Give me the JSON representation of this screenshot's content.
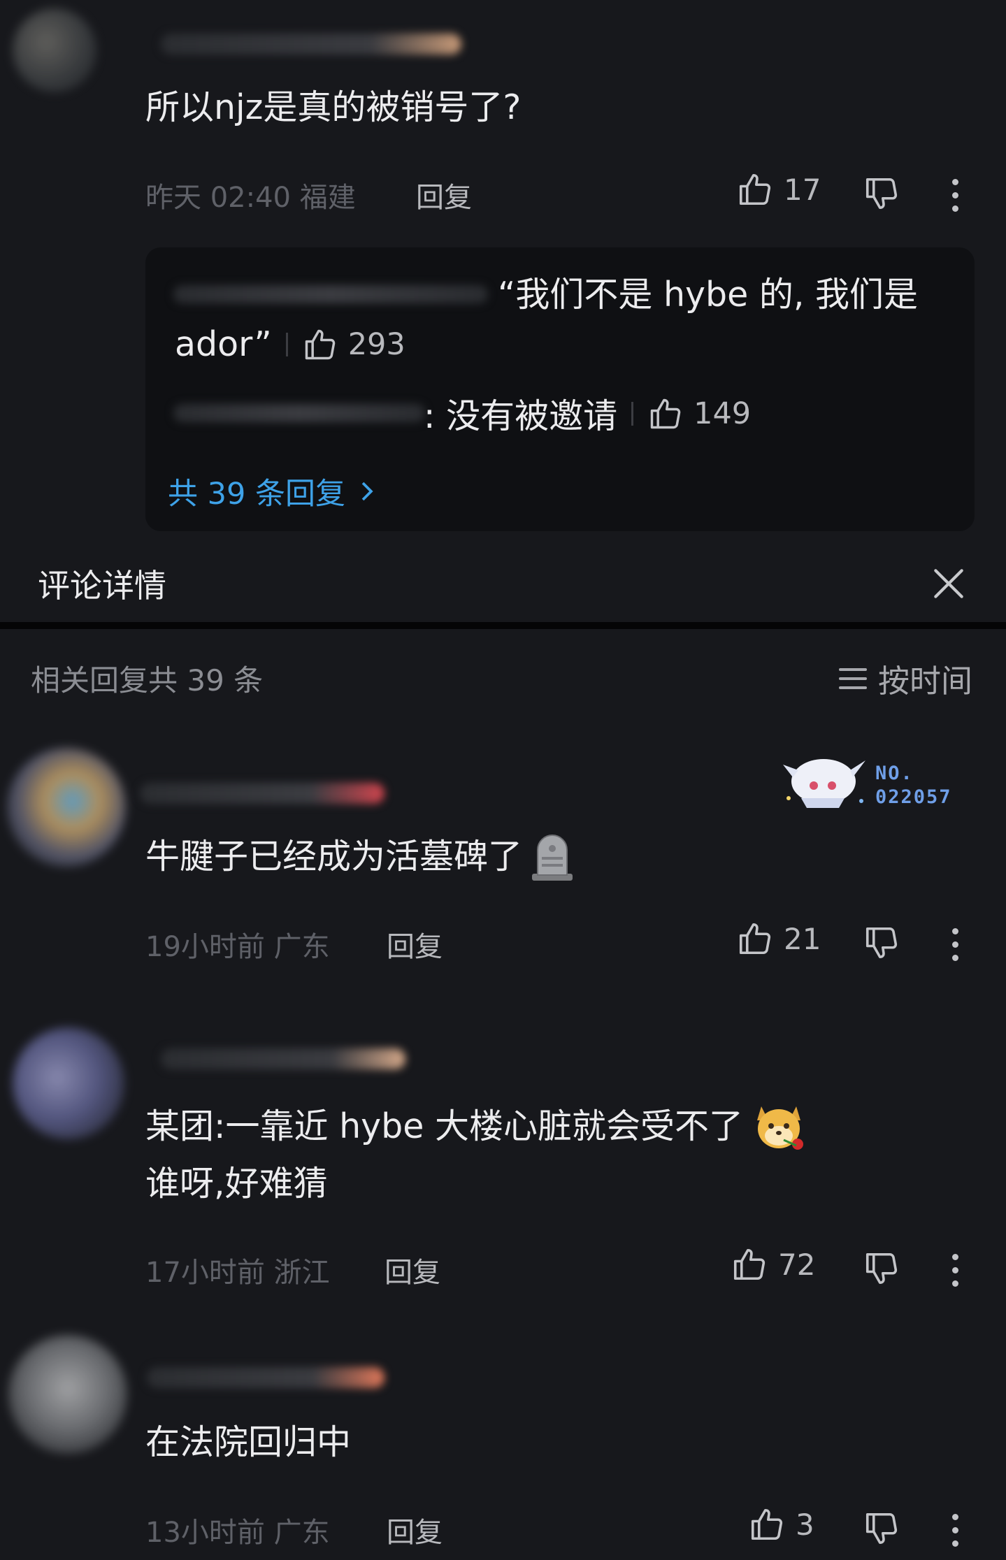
{
  "top_comment": {
    "text": "所以njz是真的被销号了?",
    "meta": "昨天 02:40 福建",
    "reply_label": "回复",
    "likes": "17"
  },
  "replies_preview": {
    "lines": [
      {
        "text_line1": "“我们不是 hybe 的, 我们是",
        "text_line2": "ador”",
        "likes": "293"
      },
      {
        "text": ": 没有被邀请",
        "likes": "149"
      }
    ],
    "view_all": "共 39 条回复"
  },
  "detail_header": {
    "title": "评论详情"
  },
  "related": {
    "count_label": "相关回复共 39 条",
    "sort_label": "按时间"
  },
  "badge": {
    "line1": "NO.",
    "line2": "022057"
  },
  "comments": [
    {
      "text": "牛腱子已经成为活墓碑了",
      "meta": "19小时前 广东",
      "reply_label": "回复",
      "likes": "21"
    },
    {
      "text_line1": "某团:一靠近 hybe 大楼心脏就会受不了",
      "text_line2": "谁呀,好难猜",
      "meta": "17小时前 浙江",
      "reply_label": "回复",
      "likes": "72"
    },
    {
      "text": "在法院回归中",
      "meta": "13小时前 广东",
      "reply_label": "回复",
      "likes": "3"
    }
  ],
  "colors": {
    "background": "#17181c",
    "accent_link": "#3ea2e8",
    "reply_box": "#0f1013"
  },
  "icons": [
    "thumbs-up-icon",
    "thumbs-down-icon",
    "more-vertical-icon",
    "close-icon",
    "sort-icon",
    "chevron-right-icon",
    "tombstone-emoji-icon",
    "dog-rose-emoji-icon"
  ]
}
